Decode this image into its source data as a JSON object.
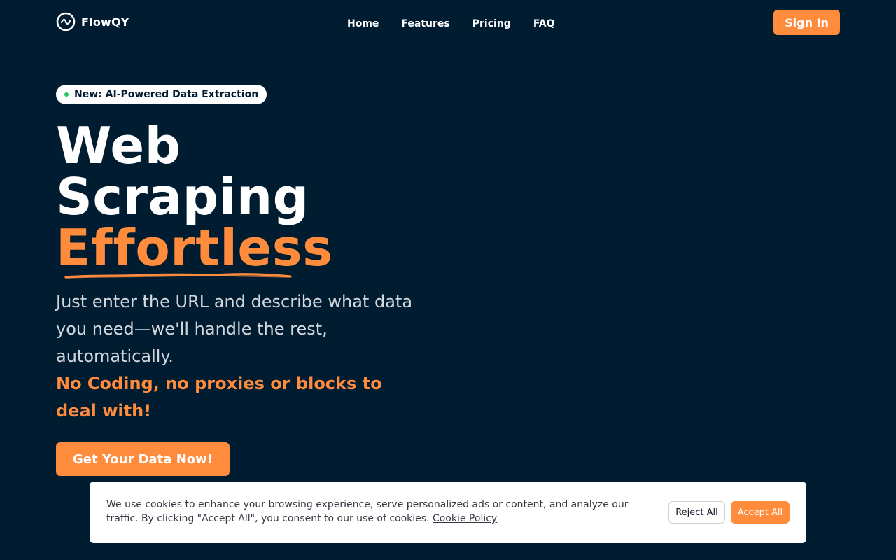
{
  "brand": {
    "name": "FlowQY",
    "logo_icon": "wave-circle-icon",
    "accent_color": "#ff8b3d",
    "background_color": "#001c30"
  },
  "nav": {
    "items": [
      {
        "label": "Home"
      },
      {
        "label": "Features"
      },
      {
        "label": "Pricing"
      },
      {
        "label": "FAQ"
      }
    ],
    "signin_label": "Sign In"
  },
  "hero": {
    "badge": "New: AI-Powered Data Extraction",
    "title_line1": "Web",
    "title_line2": "Scraping",
    "title_accent": "Effortless",
    "subtitle": "Just enter the URL and describe what data you need—we'll handle the rest, automatically.",
    "subtitle_strong": "No Coding, no proxies or blocks to deal with!",
    "cta_label": "Get Your Data Now!"
  },
  "cookie_banner": {
    "text": "We use cookies to enhance your browsing experience, serve personalized ads or content, and analyze our traffic. By clicking \"Accept All\", you consent to our use of cookies.",
    "link_label": "Cookie Policy",
    "reject_label": "Reject All",
    "accept_label": "Accept All"
  }
}
